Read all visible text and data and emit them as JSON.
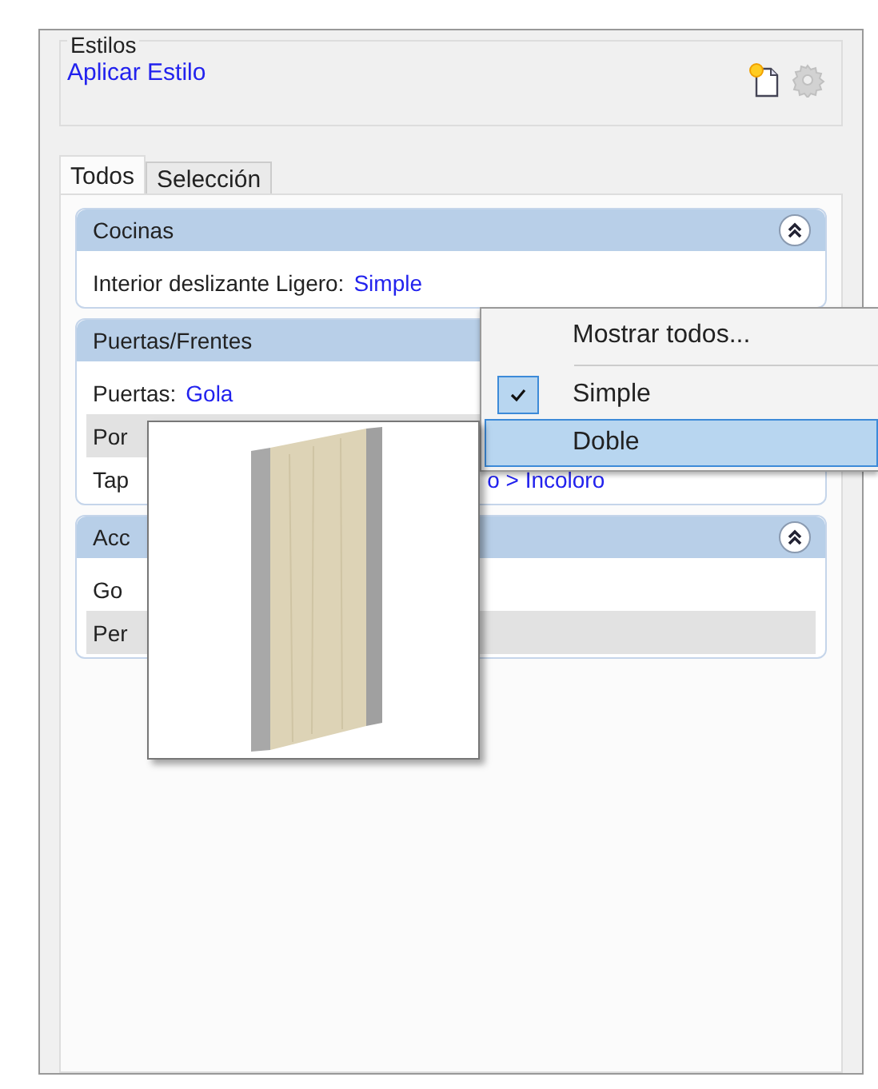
{
  "styles_group": {
    "title": "Estilos",
    "link": "Aplicar Estilo",
    "actions": [
      {
        "kind": "new",
        "disabled": false
      },
      {
        "kind": "settings",
        "disabled": true
      }
    ]
  },
  "tabs": [
    {
      "label": "Todos",
      "selected": true
    },
    {
      "label": "Selección",
      "selected": false
    }
  ],
  "sections": [
    {
      "title": "Cocinas",
      "collapse_button": true,
      "rows": [
        {
          "kind": "pair",
          "label": "Interior deslizante Ligero:",
          "value": "Simple",
          "highlighted": false
        }
      ]
    },
    {
      "title": "Puertas/Frentes",
      "collapse_button": false,
      "rows": [
        {
          "kind": "pair",
          "label": "Puertas:",
          "value": "Gola",
          "highlighted": false
        },
        {
          "kind": "pair",
          "label": "Por",
          "highlighted": true
        },
        {
          "kind": "split",
          "label": "Tap",
          "value": "o > Incoloro",
          "highlighted": false
        }
      ]
    },
    {
      "title": "Acc",
      "collapse_button": true,
      "rows": [
        {
          "kind": "pair",
          "label": "Go",
          "highlighted": false
        },
        {
          "kind": "pair",
          "label": "Per",
          "highlighted": true
        }
      ]
    }
  ],
  "context_menu": {
    "items": [
      {
        "kind": "item",
        "label": "Mostrar todos...",
        "checked": false,
        "selected": false
      },
      {
        "kind": "separator"
      },
      {
        "kind": "item",
        "label": "Simple",
        "checked": true,
        "selected": false
      },
      {
        "kind": "item",
        "label": "Doble",
        "checked": false,
        "selected": true
      }
    ]
  },
  "preview": {
    "kind": "door"
  }
}
